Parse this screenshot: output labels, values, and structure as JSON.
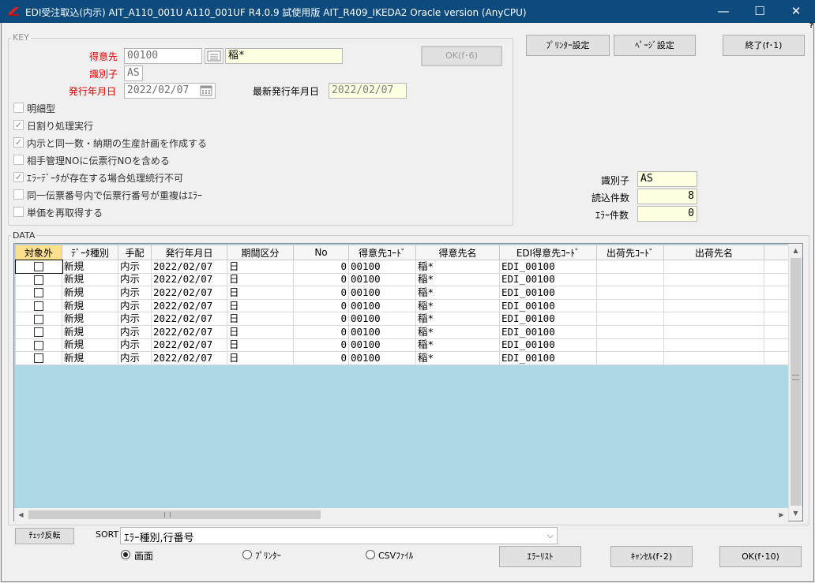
{
  "window": {
    "title": "EDI受注取込(内示) AIT_A110_001U A110_001UF R4.0.9 試使用版 AIT_R409_IKEDA2 Oracle version (AnyCPU)",
    "minimize": "—",
    "maximize": "☐",
    "close": "✕",
    "help": "?"
  },
  "key_group": {
    "legend": "KEY",
    "tokuisaki_label": "得意先",
    "tokuisaki_code": "00100",
    "tokuisaki_name": "稲*",
    "shikibetsushi_label": "識別子",
    "shikibetsushi_value": "AS",
    "hakko_label": "発行年月日",
    "hakko_value": "2022/02/07",
    "latest_label": "最新発行年月日",
    "latest_value": "2022/02/07",
    "ok_f6": "OK(f･6)",
    "checkboxes": [
      {
        "label": "明細型",
        "checked": false
      },
      {
        "label": "日割り処理実行",
        "checked": true
      },
      {
        "label": "内示と同一数・納期の生産計画を作成する",
        "checked": true
      },
      {
        "label": "相手管理NOに伝票行NOを含める",
        "checked": false
      },
      {
        "label": "ｴﾗｰﾃﾞｰﾀが存在する場合処理続行不可",
        "checked": true
      },
      {
        "label": "同一伝票番号内で伝票行番号が重複はｴﾗｰ",
        "checked": false
      },
      {
        "label": "単価を再取得する",
        "checked": false
      }
    ]
  },
  "toolbar": {
    "printer_settings": "ﾌﾟﾘﾝﾀｰ設定",
    "page_settings": "ﾍﾟｰｼﾞ設定",
    "exit": "終了(f･1)"
  },
  "summary": {
    "shikibetsushi_label": "識別子",
    "shikibetsushi_value": "AS",
    "read_count_label": "読込件数",
    "read_count": "8",
    "error_count_label": "ｴﾗｰ件数",
    "error_count": "0"
  },
  "data_group": {
    "legend": "DATA",
    "columns": [
      "対象外",
      "ﾃﾞｰﾀ種別",
      "手配",
      "発行年月日",
      "期間区分",
      "No",
      "得意先ｺｰﾄﾞ",
      "得意先名",
      "EDI得意先ｺｰﾄﾞ",
      "出荷先ｺｰﾄﾞ",
      "出荷先名"
    ],
    "rows": [
      [
        "",
        "新規",
        "内示",
        "2022/02/07",
        "日",
        "0",
        "00100",
        "稲*",
        "EDI_00100",
        "",
        ""
      ],
      [
        "",
        "新規",
        "内示",
        "2022/02/07",
        "日",
        "0",
        "00100",
        "稲*",
        "EDI_00100",
        "",
        ""
      ],
      [
        "",
        "新規",
        "内示",
        "2022/02/07",
        "日",
        "0",
        "00100",
        "稲*",
        "EDI_00100",
        "",
        ""
      ],
      [
        "",
        "新規",
        "内示",
        "2022/02/07",
        "日",
        "0",
        "00100",
        "稲*",
        "EDI_00100",
        "",
        ""
      ],
      [
        "",
        "新規",
        "内示",
        "2022/02/07",
        "日",
        "0",
        "00100",
        "稲*",
        "EDI_00100",
        "",
        ""
      ],
      [
        "",
        "新規",
        "内示",
        "2022/02/07",
        "日",
        "0",
        "00100",
        "稲*",
        "EDI_00100",
        "",
        ""
      ],
      [
        "",
        "新規",
        "内示",
        "2022/02/07",
        "日",
        "0",
        "00100",
        "稲*",
        "EDI_00100",
        "",
        ""
      ],
      [
        "",
        "新規",
        "内示",
        "2022/02/07",
        "日",
        "0",
        "00100",
        "稲*",
        "EDI_00100",
        "",
        ""
      ]
    ]
  },
  "bottom": {
    "check_invert": "ﾁｪｯｸ反転",
    "sort_label": "SORT",
    "sort_value": "ｴﾗｰ種別,行番号",
    "radio_screen": "画面",
    "radio_printer": "ﾌﾟﾘﾝﾀｰ",
    "radio_csv": "CSVﾌｧｲﾙ",
    "error_list": "ｴﾗｰﾘｽﾄ",
    "cancel": "ｷｬﾝｾﾙ(f･2)",
    "ok_f10": "OK(f･10)"
  }
}
